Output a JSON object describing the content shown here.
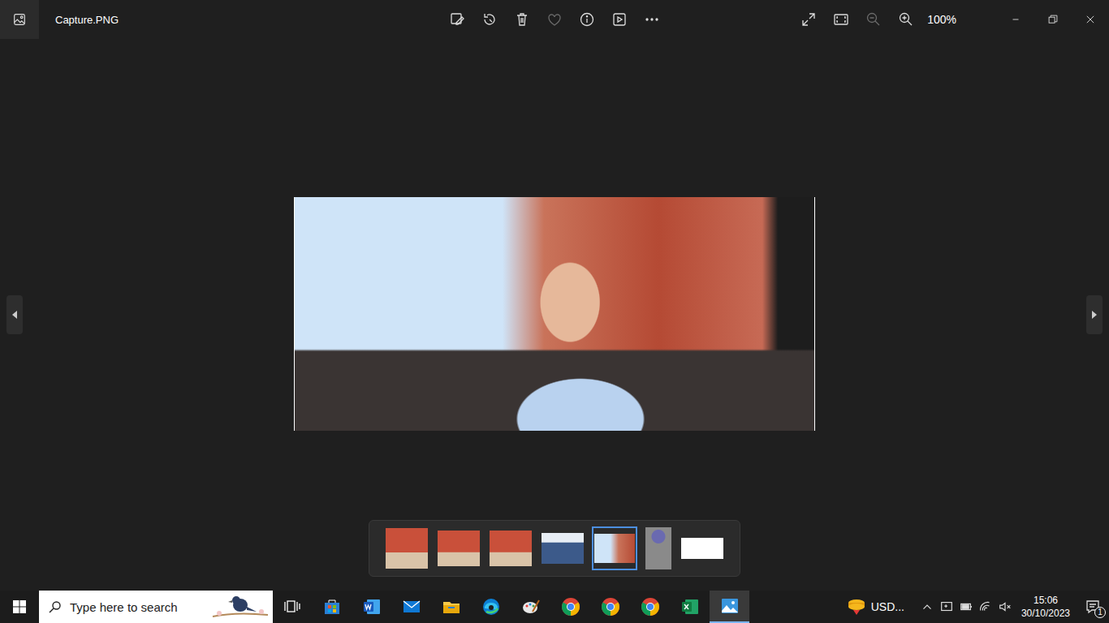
{
  "window": {
    "title": "Capture.PNG"
  },
  "toolbar": {
    "buttons": [
      {
        "disabled": false
      },
      {
        "disabled": false
      },
      {
        "disabled": false
      },
      {
        "disabled": true
      },
      {
        "disabled": false
      },
      {
        "disabled": false
      },
      {
        "disabled": false
      }
    ],
    "zoom_out": {
      "disabled": true
    },
    "zoom": "100%"
  },
  "filmstrip": {
    "thumbnails": [
      {
        "selected": false
      },
      {
        "selected": false
      },
      {
        "selected": false
      },
      {
        "selected": false
      },
      {
        "selected": true
      },
      {
        "selected": false
      },
      {
        "selected": false
      }
    ]
  },
  "taskbar": {
    "search": {
      "placeholder": "Type here to search"
    },
    "apps": [
      {
        "selected": false
      },
      {
        "selected": false
      },
      {
        "selected": false
      },
      {
        "selected": false
      },
      {
        "selected": false
      },
      {
        "selected": false
      },
      {
        "selected": false
      },
      {
        "selected": false
      },
      {
        "selected": false
      },
      {
        "selected": false
      },
      {
        "selected": true
      }
    ],
    "tray": {
      "currency": "USD...",
      "time": "15:06",
      "date": "30/10/2023",
      "notifications": "1"
    }
  }
}
